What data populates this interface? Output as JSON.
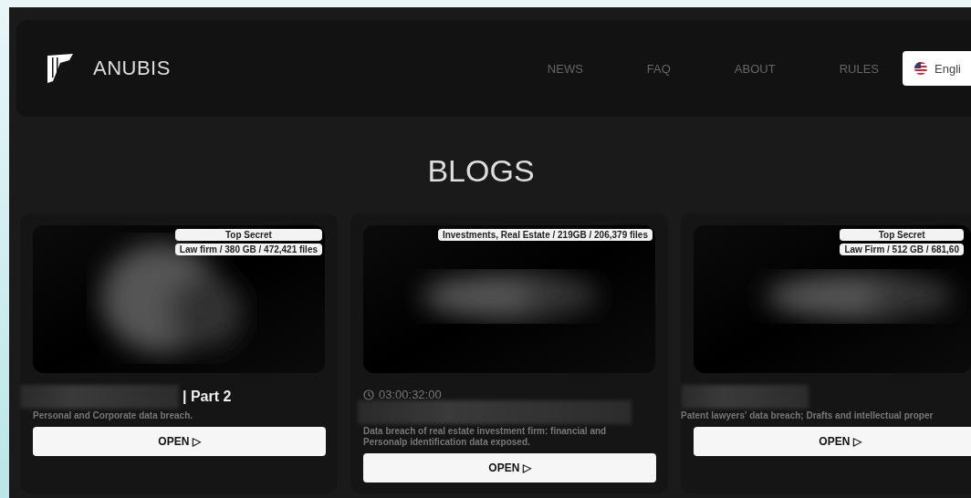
{
  "brand": {
    "name": "ANUBIS"
  },
  "nav": [
    {
      "label": "NEWS"
    },
    {
      "label": "FAQ"
    },
    {
      "label": "ABOUT"
    },
    {
      "label": "RULES"
    }
  ],
  "language": {
    "label": "Engli"
  },
  "page_title": "BLOGS",
  "posts": [
    {
      "tags": [
        "Top Secret",
        "Law firm / 380 GB / 472,421 files"
      ],
      "title_suffix": "| Part 2",
      "description": "Personal and Corporate data breach.",
      "button": "OPEN ▷"
    },
    {
      "tags": [
        "Investments, Real Estate / 219GB / 206,379 files"
      ],
      "timer": "03:00:32:00",
      "description": "Data breach of real estate investment firm: financial and Personalp identification data exposed.",
      "button": "OPEN ▷"
    },
    {
      "tags": [
        "Top Secret",
        "Law Firm / 512 GB / 681,60"
      ],
      "description": "Patent lawyers' data breach; Drafts and intellectual proper",
      "button": "OPEN ▷"
    }
  ]
}
